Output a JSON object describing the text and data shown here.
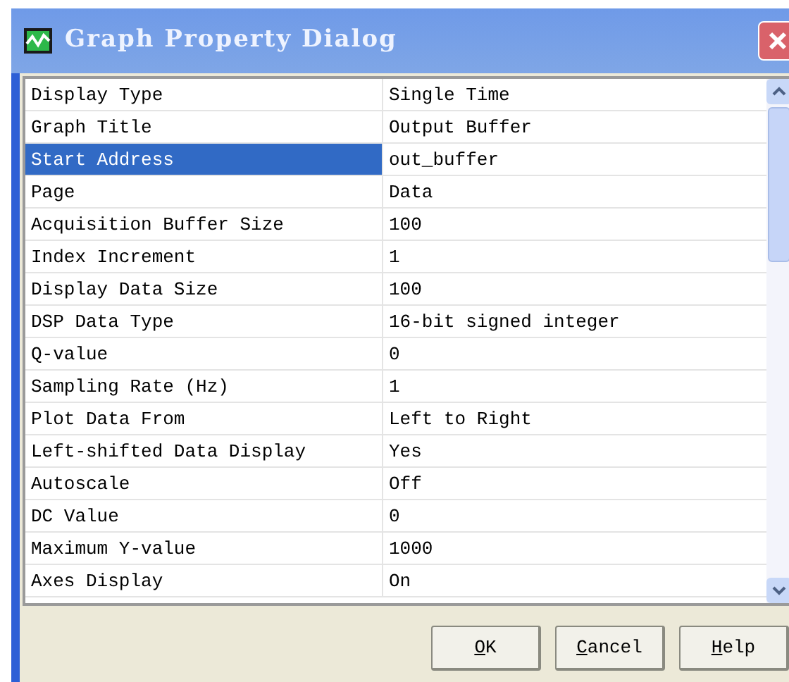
{
  "window": {
    "title": "Graph Property Dialog"
  },
  "properties": [
    {
      "name": "Display Type",
      "value": "Single Time",
      "selected": false
    },
    {
      "name": "Graph Title",
      "value": "Output Buffer",
      "selected": false
    },
    {
      "name": "Start Address",
      "value": "out_buffer",
      "selected": true
    },
    {
      "name": "Page",
      "value": "Data",
      "selected": false
    },
    {
      "name": "Acquisition Buffer Size",
      "value": "100",
      "selected": false
    },
    {
      "name": "Index Increment",
      "value": "1",
      "selected": false
    },
    {
      "name": "Display Data Size",
      "value": "100",
      "selected": false
    },
    {
      "name": "DSP Data Type",
      "value": "16-bit signed integer",
      "selected": false
    },
    {
      "name": "Q-value",
      "value": "0",
      "selected": false
    },
    {
      "name": "Sampling Rate (Hz)",
      "value": "1",
      "selected": false
    },
    {
      "name": "Plot Data From",
      "value": "Left to Right",
      "selected": false
    },
    {
      "name": "Left-shifted Data Display",
      "value": "Yes",
      "selected": false
    },
    {
      "name": "Autoscale",
      "value": "Off",
      "selected": false
    },
    {
      "name": "DC Value",
      "value": "0",
      "selected": false
    },
    {
      "name": "Maximum Y-value",
      "value": "1000",
      "selected": false
    },
    {
      "name": "Axes Display",
      "value": "On",
      "selected": false
    }
  ],
  "buttons": [
    "OK",
    "Cancel",
    "Help"
  ]
}
